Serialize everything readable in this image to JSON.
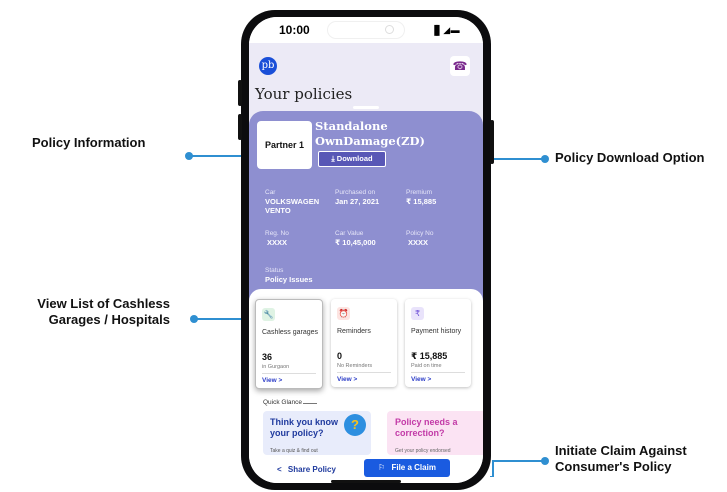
{
  "callouts": {
    "policy_information": "Policy Information",
    "policy_download": "Policy Download Option",
    "view_list": "View List of Cashless Garages / Hospitals",
    "view_list_line1": "View List of Cashless",
    "view_list_line2": "Garages / Hospitals",
    "initiate_claim_line1": "Initiate Claim Against",
    "initiate_claim_line2": "Consumer's Policy"
  },
  "status_bar": {
    "time": "10:00",
    "signal": "▐▌ ◢ ▬"
  },
  "header": {
    "logo": "pb",
    "call_icon": "☎",
    "title": "Your policies"
  },
  "policy_card": {
    "partner": "Partner 1",
    "plan_name": "Standalone OwnDamage(ZD)",
    "download_label": "⤓  Download",
    "fields": [
      {
        "label": "Car",
        "value": "VOLKSWAGEN VENTO"
      },
      {
        "label": "Purchased on",
        "value": "Jan 27, 2021"
      },
      {
        "label": "Premium",
        "value": "₹ 15,885"
      },
      {
        "label": "Reg. No",
        "value": "XXXX"
      },
      {
        "label": "Car Value",
        "value": "₹ 10,45,000"
      },
      {
        "label": "Policy No",
        "value": "XXXX"
      },
      {
        "label": "Status",
        "value": "Policy Issues"
      }
    ]
  },
  "tiles": [
    {
      "icon": "🔧",
      "label": "Cashless garages",
      "number": "36",
      "sub": "in Gurgaon",
      "view": "View >"
    },
    {
      "icon": "⏰",
      "label": "Reminders",
      "number": "0",
      "sub": "No Reminders",
      "view": "View >"
    },
    {
      "icon": "₹",
      "label": "Payment history",
      "number": "₹ 15,885",
      "sub": "Paid on time",
      "view": "View >"
    }
  ],
  "quick_glance": {
    "label": "Quick Glance",
    "promo1_title": "Think you know your policy?",
    "promo1_sub": "Take a quiz & find out",
    "promo2_title": "Policy needs a correction?",
    "promo2_sub": "Get your policy endorsed"
  },
  "bottom_bar": {
    "share": "Share Policy",
    "share_icon": "<",
    "claim": "File a Claim",
    "claim_icon": "⚐"
  },
  "colors": {
    "accent": "#2f8fd1",
    "card": "#8e8fd0",
    "primary_button": "#1a5be0"
  }
}
